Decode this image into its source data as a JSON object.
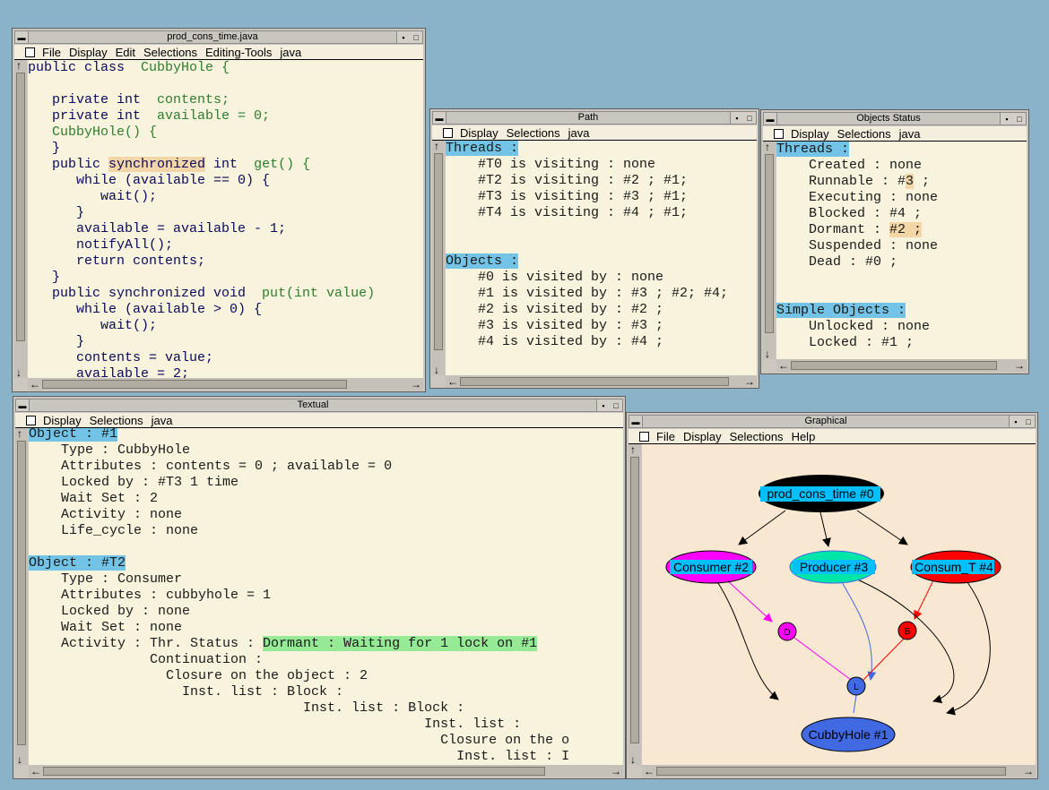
{
  "colors": {
    "desktop": "#8ab2c8",
    "window_bg": "#f8f3dc",
    "graph_bg": "#f8e8d2",
    "highlight_blue": "#72c3e6",
    "highlight_tan": "#f3d6a8",
    "highlight_green": "#96ea96",
    "node_root": "#000000",
    "node_consumer": "#ff00ff",
    "node_producer": "#00e6a8",
    "node_consum_t": "#ff0000",
    "node_cubbyhole": "#4169e1"
  },
  "code_window": {
    "title": "prod_cons_time.java",
    "menu": [
      "File",
      "Display",
      "Edit",
      "Selections",
      "Editing-Tools",
      "java"
    ],
    "lines": [
      {
        "i": "public class  ",
        "g": "CubbyHole {"
      },
      {
        "i": "",
        "g": ""
      },
      {
        "i": "   private int  ",
        "g": "contents;"
      },
      {
        "i": "   private int  ",
        "g": "available = 0;"
      },
      {
        "i": "   ",
        "g": "CubbyHole() {"
      },
      {
        "i": "   }",
        "g": ""
      },
      {
        "i": "   public ",
        "h": "synchronized",
        "i2": " int  ",
        "g": "get() {"
      },
      {
        "i": "      while (available == 0) {",
        "g": ""
      },
      {
        "i": "         wait();",
        "g": ""
      },
      {
        "i": "      }",
        "g": ""
      },
      {
        "i": "      available = available - 1;",
        "g": ""
      },
      {
        "i": "      notifyAll();",
        "g": ""
      },
      {
        "i": "      return contents;",
        "g": ""
      },
      {
        "i": "   }",
        "g": ""
      },
      {
        "i": "   public synchronized void  ",
        "g": "put(int value)"
      },
      {
        "i": "      while (available > 0) {",
        "g": ""
      },
      {
        "i": "         wait();",
        "g": ""
      },
      {
        "i": "      }",
        "g": ""
      },
      {
        "i": "      contents = value;",
        "g": ""
      },
      {
        "i": "      available = 2;",
        "g": ""
      }
    ]
  },
  "path_window": {
    "title": "Path",
    "menu": [
      "Display",
      "Selections",
      "java"
    ],
    "threads_header": "Threads :",
    "threads": [
      "    #T0 is visiting : none",
      "    #T2 is visiting : #2 ; #1;",
      "    #T3 is visiting : #3 ; #1;",
      "    #T4 is visiting : #4 ; #1;"
    ],
    "objects_header": "Objects :",
    "objects": [
      "    #0 is visited by : none",
      "    #1 is visited by : #3 ; #2; #4;",
      "    #2 is visited by : #2 ;",
      "    #3 is visited by : #3 ;",
      "    #4 is visited by : #4 ;"
    ]
  },
  "status_window": {
    "title": "Objects Status",
    "menu": [
      "Display",
      "Selections",
      "java"
    ],
    "threads_header": "Threads :",
    "created": "    Created : none",
    "runnable_pre": "    Runnable : #",
    "runnable_hl": "3",
    "runnable_post": " ;",
    "executing": "    Executing : none",
    "blocked": "    Blocked : #4 ;",
    "dormant_pre": "    Dormant : ",
    "dormant_hl": "#2 ;",
    "suspended": "    Suspended : none",
    "dead": "    Dead : #0 ;",
    "simple_header": "Simple Objects :",
    "unlocked": "    Unlocked : none",
    "locked": "    Locked : #1 ;"
  },
  "textual_window": {
    "title": "Textual",
    "menu": [
      "Display",
      "Selections",
      "java"
    ],
    "obj1_header": "Object : #1",
    "obj1": [
      "    Type : CubbyHole",
      "    Attributes : contents = 0 ; available = 0",
      "    Locked by : #T3 1 time",
      "    Wait Set : 2",
      "    Activity : none",
      "    Life_cycle : none"
    ],
    "obj2_header": "Object : #T2",
    "obj2": [
      "    Type : Consumer",
      "    Attributes : cubbyhole = 1",
      "    Locked by : none",
      "    Wait Set : none"
    ],
    "activity_pre": "    Activity : Thr. Status : ",
    "activity_hl": "Dormant : Waiting for 1 lock on #1",
    "tail": [
      "               Continuation :",
      "                 Closure on the object : 2",
      "                   Inst. list : Block :",
      "                                  Inst. list : Block :",
      "                                                 Inst. list :",
      "                                                   Closure on the o",
      "                                                     Inst. list : I"
    ]
  },
  "graphical_window": {
    "title": "Graphical",
    "menu": [
      "File",
      "Display",
      "Selections",
      "Help"
    ],
    "nodes": {
      "root": "prod_cons_time #0",
      "consumer": "Consumer #2",
      "producer": "Producer #3",
      "consum_t": "Consum_T #4",
      "cubbyhole": "CubbyHole #1",
      "d": "D",
      "b": "B",
      "l": "L"
    }
  }
}
